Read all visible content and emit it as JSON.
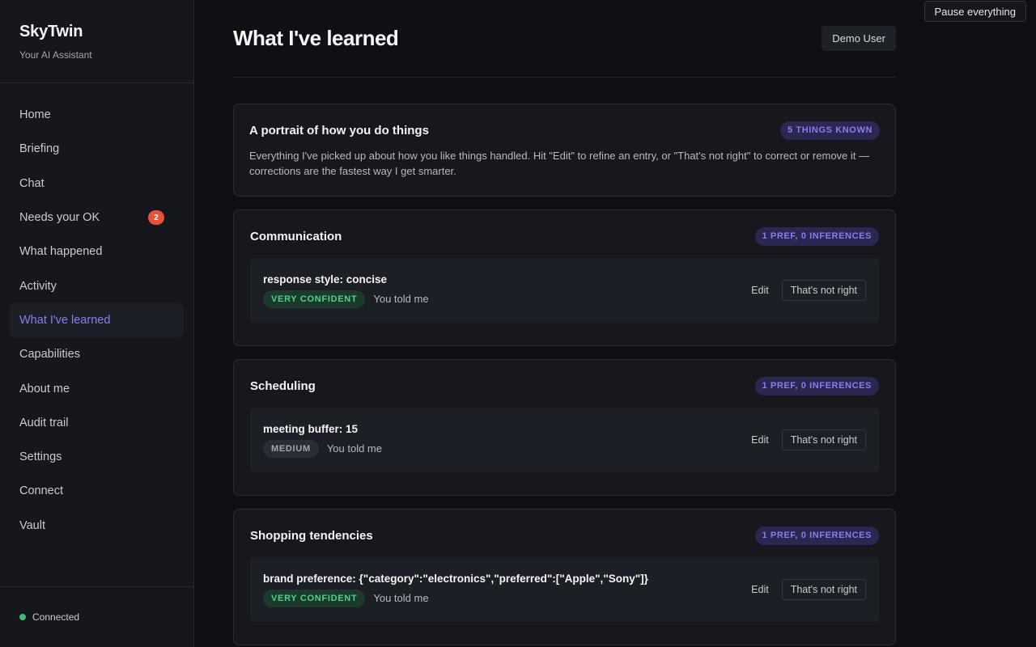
{
  "app": {
    "name": "SkyTwin",
    "subtitle": "Your AI Assistant",
    "status": "Connected",
    "pause_label": "Pause everything"
  },
  "colors": {
    "accent": "#8b7cf0",
    "badge": "#e5533d",
    "connected": "#3fbf74",
    "confident": "#4fd18b"
  },
  "sidebar": {
    "items": [
      {
        "label": "Home"
      },
      {
        "label": "Briefing"
      },
      {
        "label": "Chat"
      },
      {
        "label": "Needs your OK",
        "badge": "2"
      },
      {
        "label": "What happened"
      },
      {
        "label": "Activity"
      },
      {
        "label": "What I've learned",
        "active": true
      },
      {
        "label": "Capabilities"
      },
      {
        "label": "About me"
      },
      {
        "label": "Audit trail"
      },
      {
        "label": "Settings"
      },
      {
        "label": "Connect"
      },
      {
        "label": "Vault"
      }
    ]
  },
  "header": {
    "title": "What I've learned",
    "user": "Demo User"
  },
  "intro": {
    "title": "A portrait of how you do things",
    "badge": "5 THINGS KNOWN",
    "description": "Everything I've picked up about how you like things handled. Hit \"Edit\" to refine an entry, or \"That's not right\" to correct or remove it — corrections are the fastest way I get smarter."
  },
  "sections": [
    {
      "title": "Communication",
      "badge": "1 PREF, 0 INFERENCES",
      "pref": {
        "key": "response style: concise",
        "confidence": "VERY CONFIDENT",
        "source": "You told me",
        "edit": "Edit",
        "wrong": "That's not right"
      }
    },
    {
      "title": "Scheduling",
      "badge": "1 PREF, 0 INFERENCES",
      "pref": {
        "key": "meeting buffer: 15",
        "confidence": "MEDIUM",
        "source": "You told me",
        "edit": "Edit",
        "wrong": "That's not right"
      }
    },
    {
      "title": "Shopping tendencies",
      "badge": "1 PREF, 0 INFERENCES",
      "pref": {
        "key": "brand preference: {\"category\":\"electronics\",\"preferred\":[\"Apple\",\"Sony\"]}",
        "confidence": "VERY CONFIDENT",
        "source": "You told me",
        "edit": "Edit",
        "wrong": "That's not right"
      }
    }
  ]
}
